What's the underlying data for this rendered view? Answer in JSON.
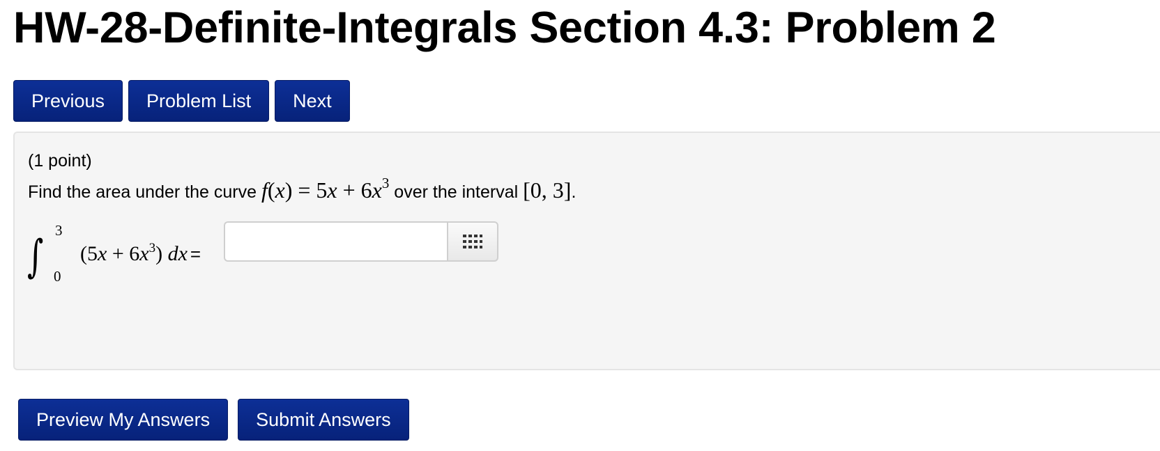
{
  "page": {
    "title": "HW-28-Definite-Integrals Section 4.3: Problem 2"
  },
  "nav": {
    "previous_label": "Previous",
    "problem_list_label": "Problem List",
    "next_label": "Next"
  },
  "problem": {
    "points": "(1 point)",
    "statement_prefix": "Find the area under the curve",
    "function_f": "f",
    "function_lparen": "(",
    "function_var": "x",
    "function_rparen_eq": ") = 5",
    "function_x1": "x",
    "function_plus": " + 6",
    "function_x2": "x",
    "function_exponent": "3",
    "statement_mid": "over the interval",
    "interval": "[0, 3]",
    "statement_end": "."
  },
  "integral": {
    "sign": "∫",
    "upper_limit": "3",
    "lower_limit": "0",
    "open": "(5",
    "x1": "x",
    "plus": " + 6",
    "x2": "x",
    "exponent": "3",
    "close": ") ",
    "dx": "dx",
    "equals": "="
  },
  "answer": {
    "value": "",
    "placeholder": "",
    "palette_icon": "equation-palette-icon"
  },
  "footer": {
    "preview_label": "Preview My Answers",
    "submit_label": "Submit Answers"
  },
  "colors": {
    "button_bg": "#0b2a8a",
    "button_text": "#ffffff",
    "panel_bg": "#f5f5f5",
    "panel_border": "#e4e4e4"
  }
}
